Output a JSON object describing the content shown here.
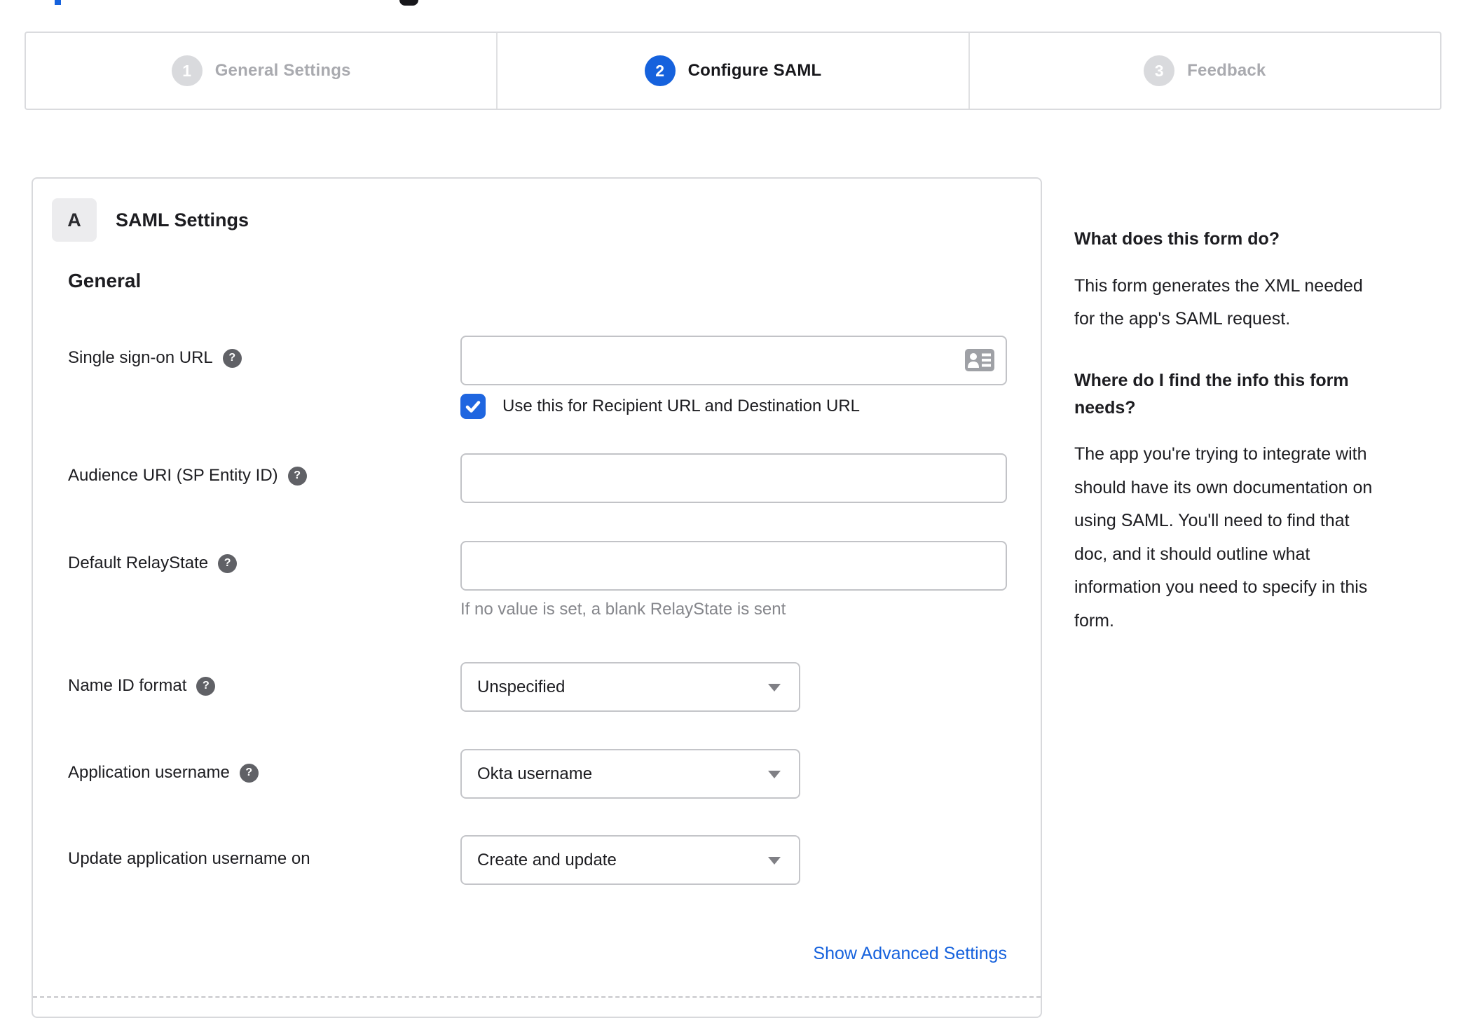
{
  "colors": {
    "accent_blue": "#1662dd",
    "text_dark": "#1d1d21",
    "hint_gray": "#85868b",
    "inactive_gray": "#a9aaaf",
    "border_gray": "#c4c5c9"
  },
  "icons": {
    "help_glyph": "?"
  },
  "stepper": {
    "steps": [
      {
        "number": "1",
        "label": "General Settings",
        "state": "inactive"
      },
      {
        "number": "2",
        "label": "Configure SAML",
        "state": "active"
      },
      {
        "number": "3",
        "label": "Feedback",
        "state": "inactive"
      }
    ]
  },
  "panel": {
    "badge": "A",
    "title": "SAML Settings",
    "section": "General",
    "sso": {
      "label": "Single sign-on URL",
      "value": "",
      "checkbox_label": "Use this for Recipient URL and Destination URL",
      "checked": true
    },
    "audience": {
      "label": "Audience URI (SP Entity ID)",
      "value": ""
    },
    "relay": {
      "label": "Default RelayState",
      "value": "",
      "hint": "If no value is set, a blank RelayState is sent"
    },
    "name_id": {
      "label": "Name ID format",
      "value": "Unspecified"
    },
    "app_username": {
      "label": "Application username",
      "value": "Okta username"
    },
    "update_username": {
      "label": "Update application username on",
      "value": "Create and update"
    },
    "advanced_link": "Show Advanced Settings"
  },
  "sidebar": {
    "q1_title": "What does this form do?",
    "q1_body": "This form generates the XML needed\nfor the app's SAML request.",
    "q2_title": "Where do I find the info this form\nneeds?",
    "q2_body": "The app you're trying to integrate with\nshould have its own documentation on\nusing SAML. You'll need to find that\ndoc, and it should outline what\ninformation you need to specify in this\nform."
  }
}
